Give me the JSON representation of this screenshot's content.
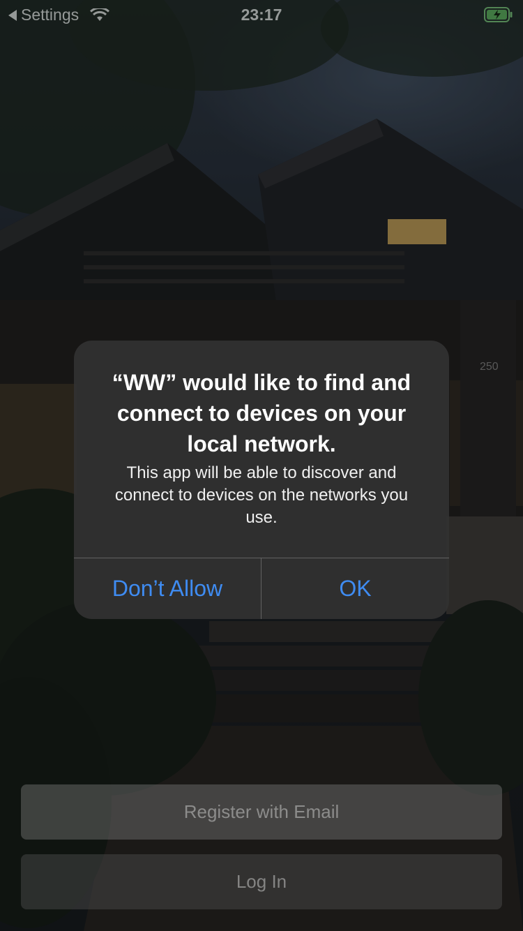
{
  "status_bar": {
    "back_label": "Settings",
    "time": "23:17",
    "icons": [
      "back-arrow-icon",
      "wifi-icon",
      "battery-charging-icon"
    ]
  },
  "background": {
    "house_number": "250",
    "description_colors": {
      "sky": "#2c3540",
      "foliage": "#1d2a22",
      "window_light": "#c9a55a"
    }
  },
  "alert": {
    "title": "“WW” would like to find and connect to devices on your local network.",
    "message": "This app will be able to discover and connect to devices on the networks you use.",
    "deny_label": "Don’t Allow",
    "ok_label": "OK",
    "button_color": "#3f8cf2"
  },
  "buttons": {
    "register_label": "Register with Email",
    "login_label": "Log In"
  }
}
